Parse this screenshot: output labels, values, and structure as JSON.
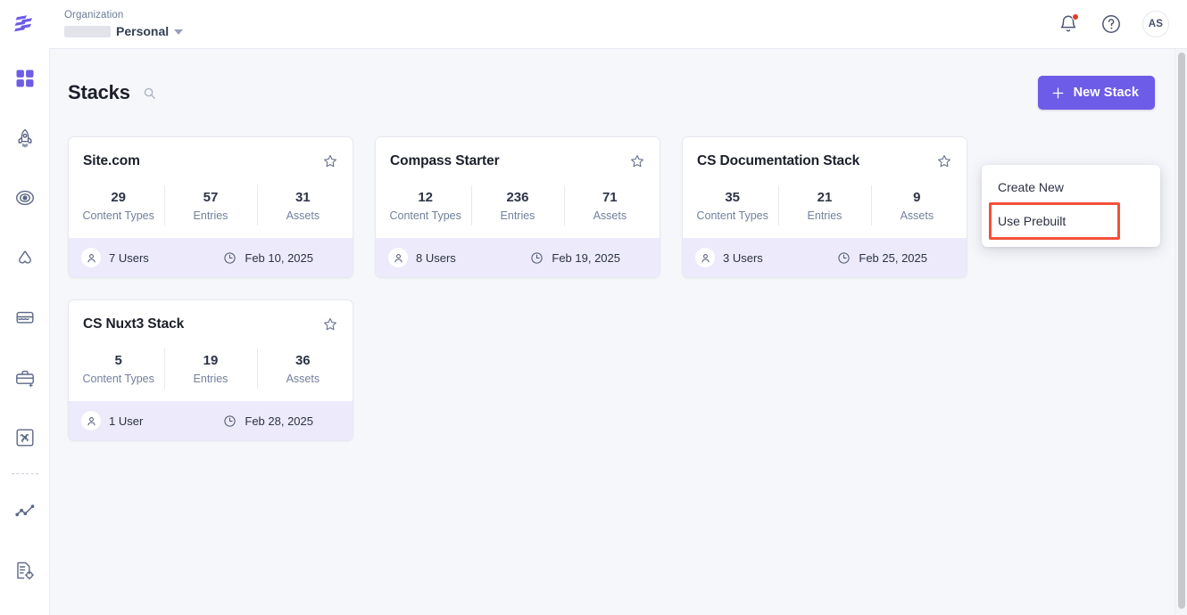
{
  "header": {
    "logo_icon": "contentstack-logo-icon",
    "org_label": "Organization",
    "org_name": "Personal",
    "org_redacted": true,
    "notifications_icon": "bell-icon",
    "has_notification_dot": true,
    "help_icon": "question-circle-icon",
    "avatar_initials": "AS"
  },
  "sidebar": {
    "items": [
      {
        "name": "stacks",
        "icon": "grid-squares-icon",
        "active": true
      },
      {
        "name": "launch",
        "icon": "rocket-icon",
        "active": false
      },
      {
        "name": "automate",
        "icon": "target-eye-icon",
        "active": false
      },
      {
        "name": "brand-kit",
        "icon": "compass-arrows-icon",
        "active": false
      },
      {
        "name": "marketplace",
        "icon": "store-icon",
        "active": false
      },
      {
        "name": "toolbox",
        "icon": "briefcase-plus-icon",
        "active": false
      },
      {
        "name": "extensions",
        "icon": "puzzle-frame-icon",
        "active": false
      },
      {
        "name": "analytics",
        "icon": "line-chart-icon",
        "active": false
      },
      {
        "name": "settings-docs",
        "icon": "document-gear-icon",
        "active": false
      }
    ]
  },
  "page": {
    "title": "Stacks",
    "search_icon": "search-icon",
    "new_stack_label": "New Stack",
    "new_stack_icon": "plus-icon",
    "accent_color": "#6c5ce7",
    "highlight_color": "#f4503a"
  },
  "dropdown": {
    "visible": true,
    "items": [
      {
        "label": "Create New",
        "highlighted": false
      },
      {
        "label": "Use Prebuilt",
        "highlighted": true
      }
    ]
  },
  "stat_labels": {
    "content_types": "Content Types",
    "entries": "Entries",
    "assets": "Assets"
  },
  "cards": [
    {
      "title": "Site.com",
      "star_icon": "star-outline-icon",
      "content_types": "29",
      "entries": "57",
      "assets": "31",
      "users": "7 Users",
      "date": "Feb 10, 2025",
      "user_icon": "person-icon",
      "clock_icon": "clock-icon"
    },
    {
      "title": "Compass Starter",
      "star_icon": "star-outline-icon",
      "content_types": "12",
      "entries": "236",
      "assets": "71",
      "users": "8 Users",
      "date": "Feb 19, 2025",
      "user_icon": "person-icon",
      "clock_icon": "clock-icon"
    },
    {
      "title": "CS Documentation Stack",
      "star_icon": "star-outline-icon",
      "content_types": "35",
      "entries": "21",
      "assets": "9",
      "users": "3 Users",
      "date": "Feb 25, 2025",
      "user_icon": "person-icon",
      "clock_icon": "clock-icon"
    },
    {
      "title": "CS Nuxt3 Stack",
      "star_icon": "star-outline-icon",
      "content_types": "5",
      "entries": "19",
      "assets": "36",
      "users": "1 User",
      "date": "Feb 28, 2025",
      "user_icon": "person-icon",
      "clock_icon": "clock-icon"
    }
  ]
}
